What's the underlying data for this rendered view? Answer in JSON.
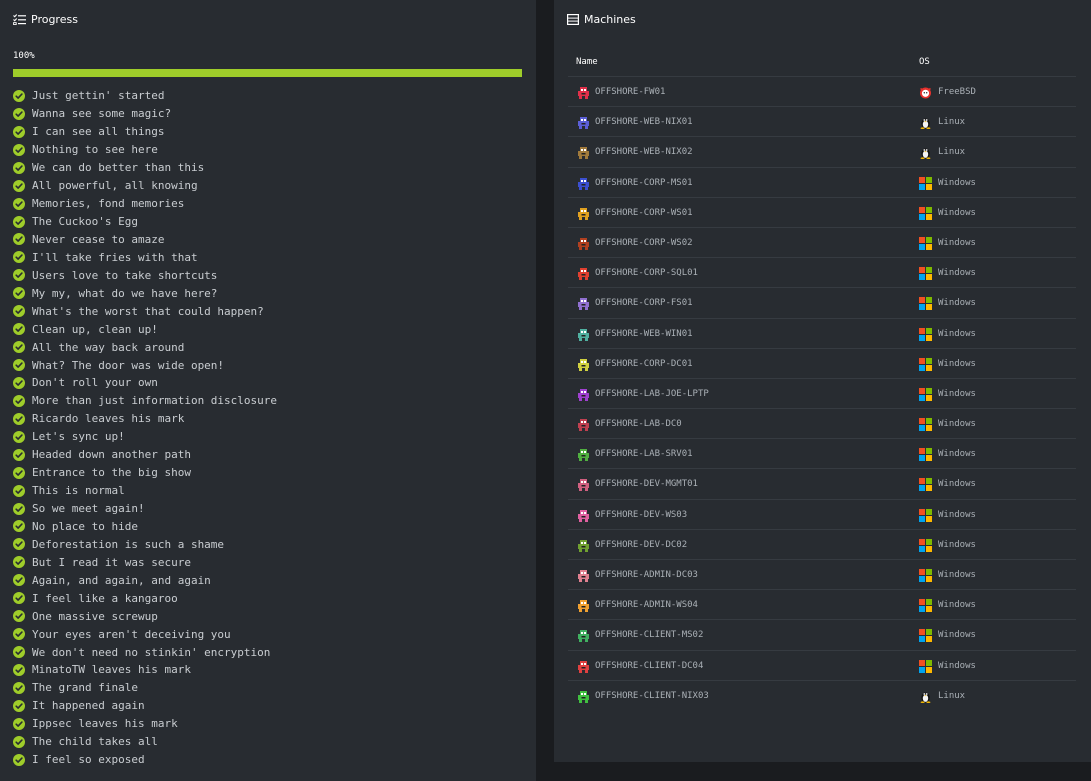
{
  "progress": {
    "title": "Progress",
    "percent_label": "100%",
    "percent_value": 100,
    "bar_color": "#9fcd2a",
    "tasks": [
      "Just gettin' started",
      "Wanna see some magic?",
      "I can see all things",
      "Nothing to see here",
      "We can do better than this",
      "All powerful, all knowing",
      "Memories, fond memories",
      "The Cuckoo's Egg",
      "Never cease to amaze",
      "I'll take fries with that",
      "Users love to take shortcuts",
      "My my, what do we have here?",
      "What's the worst that could happen?",
      "Clean up, clean up!",
      "All the way back around",
      "What? The door was wide open!",
      "Don't roll your own",
      "More than just information disclosure",
      "Ricardo leaves his mark",
      "Let's sync up!",
      "Headed down another path",
      "Entrance to the big show",
      "This is normal",
      "So we meet again!",
      "No place to hide",
      "Deforestation is such a shame",
      "But I read it was secure",
      "Again, and again, and again",
      "I feel like a kangaroo",
      "One massive screwup",
      "Your eyes aren't deceiving you",
      "We don't need no stinkin' encryption",
      "MinatoTW leaves his mark",
      "The grand finale",
      "It happened again",
      "Ippsec leaves his mark",
      "The child takes all",
      "I feel so exposed"
    ]
  },
  "machines": {
    "title": "Machines",
    "columns": {
      "name": "Name",
      "os": "OS"
    },
    "rows": [
      {
        "name": "OFFSHORE-FW01",
        "os": "FreeBSD",
        "os_icon": "freebsd-icon",
        "avatar_color": "#e0304a"
      },
      {
        "name": "OFFSHORE-WEB-NIX01",
        "os": "Linux",
        "os_icon": "linux-icon",
        "avatar_color": "#5b5fd6"
      },
      {
        "name": "OFFSHORE-WEB-NIX02",
        "os": "Linux",
        "os_icon": "linux-icon",
        "avatar_color": "#a07a3c"
      },
      {
        "name": "OFFSHORE-CORP-MS01",
        "os": "Windows",
        "os_icon": "windows-icon",
        "avatar_color": "#3b4fd0"
      },
      {
        "name": "OFFSHORE-CORP-WS01",
        "os": "Windows",
        "os_icon": "windows-icon",
        "avatar_color": "#e0a020"
      },
      {
        "name": "OFFSHORE-CORP-WS02",
        "os": "Windows",
        "os_icon": "windows-icon",
        "avatar_color": "#b04020"
      },
      {
        "name": "OFFSHORE-CORP-SQL01",
        "os": "Windows",
        "os_icon": "windows-icon",
        "avatar_color": "#e04030"
      },
      {
        "name": "OFFSHORE-CORP-FS01",
        "os": "Windows",
        "os_icon": "windows-icon",
        "avatar_color": "#9070d0"
      },
      {
        "name": "OFFSHORE-WEB-WIN01",
        "os": "Windows",
        "os_icon": "windows-icon",
        "avatar_color": "#50b0a0"
      },
      {
        "name": "OFFSHORE-CORP-DC01",
        "os": "Windows",
        "os_icon": "windows-icon",
        "avatar_color": "#d0d040"
      },
      {
        "name": "OFFSHORE-LAB-JOE-LPTP",
        "os": "Windows",
        "os_icon": "windows-icon",
        "avatar_color": "#a040d0"
      },
      {
        "name": "OFFSHORE-LAB-DC0",
        "os": "Windows",
        "os_icon": "windows-icon",
        "avatar_color": "#c04050"
      },
      {
        "name": "OFFSHORE-LAB-SRV01",
        "os": "Windows",
        "os_icon": "windows-icon",
        "avatar_color": "#50b040"
      },
      {
        "name": "OFFSHORE-DEV-MGMT01",
        "os": "Windows",
        "os_icon": "windows-icon",
        "avatar_color": "#d06080"
      },
      {
        "name": "OFFSHORE-DEV-WS03",
        "os": "Windows",
        "os_icon": "windows-icon",
        "avatar_color": "#e060a0"
      },
      {
        "name": "OFFSHORE-DEV-DC02",
        "os": "Windows",
        "os_icon": "windows-icon",
        "avatar_color": "#70a030"
      },
      {
        "name": "OFFSHORE-ADMIN-DC03",
        "os": "Windows",
        "os_icon": "windows-icon",
        "avatar_color": "#e08090"
      },
      {
        "name": "OFFSHORE-ADMIN-WS04",
        "os": "Windows",
        "os_icon": "windows-icon",
        "avatar_color": "#f0a030"
      },
      {
        "name": "OFFSHORE-CLIENT-MS02",
        "os": "Windows",
        "os_icon": "windows-icon",
        "avatar_color": "#40b060"
      },
      {
        "name": "OFFSHORE-CLIENT-DC04",
        "os": "Windows",
        "os_icon": "windows-icon",
        "avatar_color": "#e04040"
      },
      {
        "name": "OFFSHORE-CLIENT-NIX03",
        "os": "Linux",
        "os_icon": "linux-icon",
        "avatar_color": "#40c040"
      }
    ]
  }
}
